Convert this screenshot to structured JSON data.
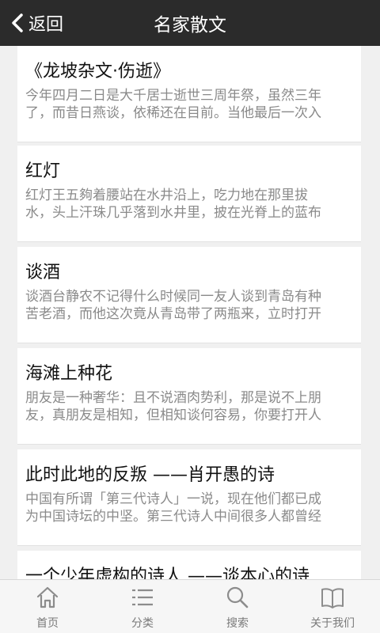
{
  "header": {
    "back_label": "返回",
    "title": "名家散文"
  },
  "articles": [
    {
      "title": "《龙坡杂文·伤逝》",
      "summary": "今年四月二日是大千居士逝世三周年祭，虽然三年\n了，而昔日燕谈，依稀还在目前。当他最后一次入"
    },
    {
      "title": "红灯",
      "summary": "红灯王五夠着腰站在水井沿上，吃力地在那里拔\n水，头上汗珠几乎落到水井里，披在光脊上的蓝布"
    },
    {
      "title": "谈酒",
      "summary": "谈酒台静农不记得什么时候同一友人谈到青岛有种\n苦老酒，而他这次竟从青岛带了两瓶来，立时打开"
    },
    {
      "title": "海滩上种花",
      "summary": "朋友是一种奢华：且不说酒肉势利，那是说不上朋\n友，真朋友是相知，但相知谈何容易，你要打开人"
    },
    {
      "title": "此时此地的反叛 ——肖开愚的诗",
      "summary": "中国有所谓「第三代诗人」一说，现在他们都已成\n为中国诗坛的中坚。第三代诗人中间很多人都曾经"
    },
    {
      "title": "一个少年虚构的诗人 ——谈本心的诗",
      "summary": ""
    }
  ],
  "tabs": [
    {
      "label": "首页",
      "icon": "home-icon"
    },
    {
      "label": "分类",
      "icon": "list-icon"
    },
    {
      "label": "搜索",
      "icon": "search-icon"
    },
    {
      "label": "关于我们",
      "icon": "book-icon"
    }
  ],
  "colors": {
    "header_bg": "#2b2b2b",
    "background": "#f0f0f0",
    "summary_text": "#8a8a8a",
    "tab_icon": "#8c8c8c"
  }
}
